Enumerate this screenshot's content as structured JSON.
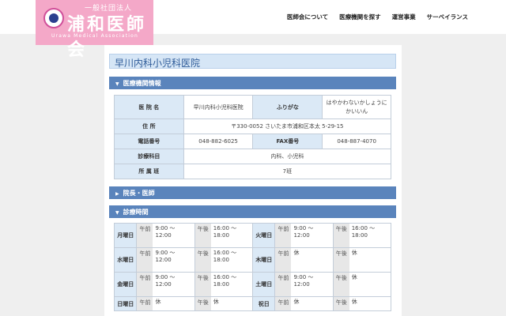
{
  "logo": {
    "sub": "一般社団法人",
    "main": "浦和医師会",
    "en": "Urawa Medical Association"
  },
  "nav": [
    "医師会について",
    "医療機関を探す",
    "運営事業",
    "サーベイランス"
  ],
  "page": {
    "title": "早川内科小児科医院"
  },
  "sections": {
    "info": "医療機関情報",
    "doctor": "院長・医師",
    "hours": "診療時間"
  },
  "info": {
    "name_label": "医 院 名",
    "name": "早川内科小児科医院",
    "kana_label": "ふりがな",
    "kana": "はやかわないかしょうにかいいん",
    "address_label": "住 所",
    "address": "〒330-0052 さいたま市浦和区本太 5-29-15",
    "phone_label": "電話番号",
    "phone": "048-882-6025",
    "fax_label": "FAX番号",
    "fax": "048-887-4070",
    "dept_label": "診療科目",
    "dept": "内科、小児科",
    "group_label": "所 属 班",
    "group": "7班"
  },
  "hours": [
    {
      "day": "月曜日",
      "am": "9:00 〜 12:00",
      "pm": "16:00 〜 18:00"
    },
    {
      "day": "火曜日",
      "am": "9:00 〜 12:00",
      "pm": "16:00 〜 18:00"
    },
    {
      "day": "水曜日",
      "am": "9:00 〜 12:00",
      "pm": "16:00 〜 18:00"
    },
    {
      "day": "木曜日",
      "am": "休",
      "pm": "休"
    },
    {
      "day": "金曜日",
      "am": "9:00 〜 12:00",
      "pm": "16:00 〜 18:00"
    },
    {
      "day": "土曜日",
      "am": "9:00 〜 12:00",
      "pm": "休"
    },
    {
      "day": "日曜日",
      "am": "休",
      "pm": "休"
    },
    {
      "day": "祝日",
      "am": "休",
      "pm": "休"
    }
  ],
  "labels": {
    "am": "午前",
    "pm": "午後"
  },
  "colors": {
    "header_pink": "#f4a8c8",
    "section_bar": "#5a84bc",
    "label_cell": "#dbe9f6"
  }
}
